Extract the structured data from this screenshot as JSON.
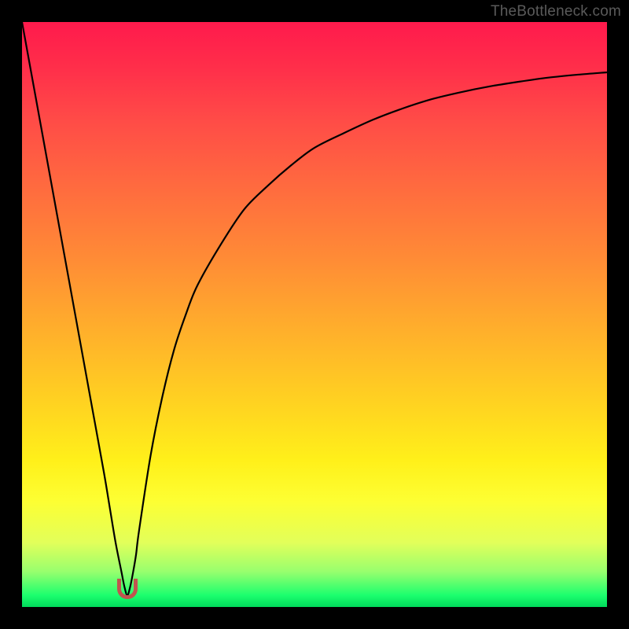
{
  "attribution": "TheBottleneck.com",
  "chart_data": {
    "type": "line",
    "title": "",
    "xlabel": "",
    "ylabel": "",
    "xlim": [
      0,
      100
    ],
    "ylim": [
      0,
      100
    ],
    "grid": false,
    "legend": false,
    "x": [
      0,
      2,
      4,
      6,
      8,
      10,
      12,
      14,
      15,
      16,
      17,
      17.5,
      18,
      18.5,
      19,
      19.5,
      20,
      22,
      24,
      26,
      28,
      30,
      34,
      38,
      42,
      46,
      50,
      55,
      60,
      65,
      70,
      75,
      80,
      85,
      90,
      95,
      100
    ],
    "series": [
      {
        "name": "bottleneck-curve",
        "values": [
          100,
          89,
          78,
          67,
          56,
          45,
          34,
          23,
          17,
          11,
          6,
          3.5,
          2,
          3.5,
          6,
          9,
          13,
          26,
          36,
          44,
          50,
          55,
          62,
          68,
          72,
          75.5,
          78.5,
          81,
          83.3,
          85.2,
          86.8,
          88,
          89,
          89.8,
          90.5,
          91,
          91.4
        ]
      }
    ],
    "marker": {
      "x_center": 18,
      "width_pct": 3.6,
      "top_pct": 95.2,
      "bottom_pct": 98.5,
      "color": "#c0544f"
    },
    "background_gradient": {
      "stops": [
        {
          "pct": 0,
          "color": "#ff1a4c"
        },
        {
          "pct": 8,
          "color": "#ff2f4a"
        },
        {
          "pct": 17,
          "color": "#ff4c47"
        },
        {
          "pct": 28,
          "color": "#ff6a3f"
        },
        {
          "pct": 40,
          "color": "#ff8a36"
        },
        {
          "pct": 52,
          "color": "#ffad2c"
        },
        {
          "pct": 65,
          "color": "#ffd221"
        },
        {
          "pct": 75,
          "color": "#fff01a"
        },
        {
          "pct": 82,
          "color": "#fdff33"
        },
        {
          "pct": 89,
          "color": "#e2ff5a"
        },
        {
          "pct": 94,
          "color": "#97ff6e"
        },
        {
          "pct": 98,
          "color": "#1cff6e"
        },
        {
          "pct": 100,
          "color": "#00da5b"
        }
      ]
    }
  }
}
